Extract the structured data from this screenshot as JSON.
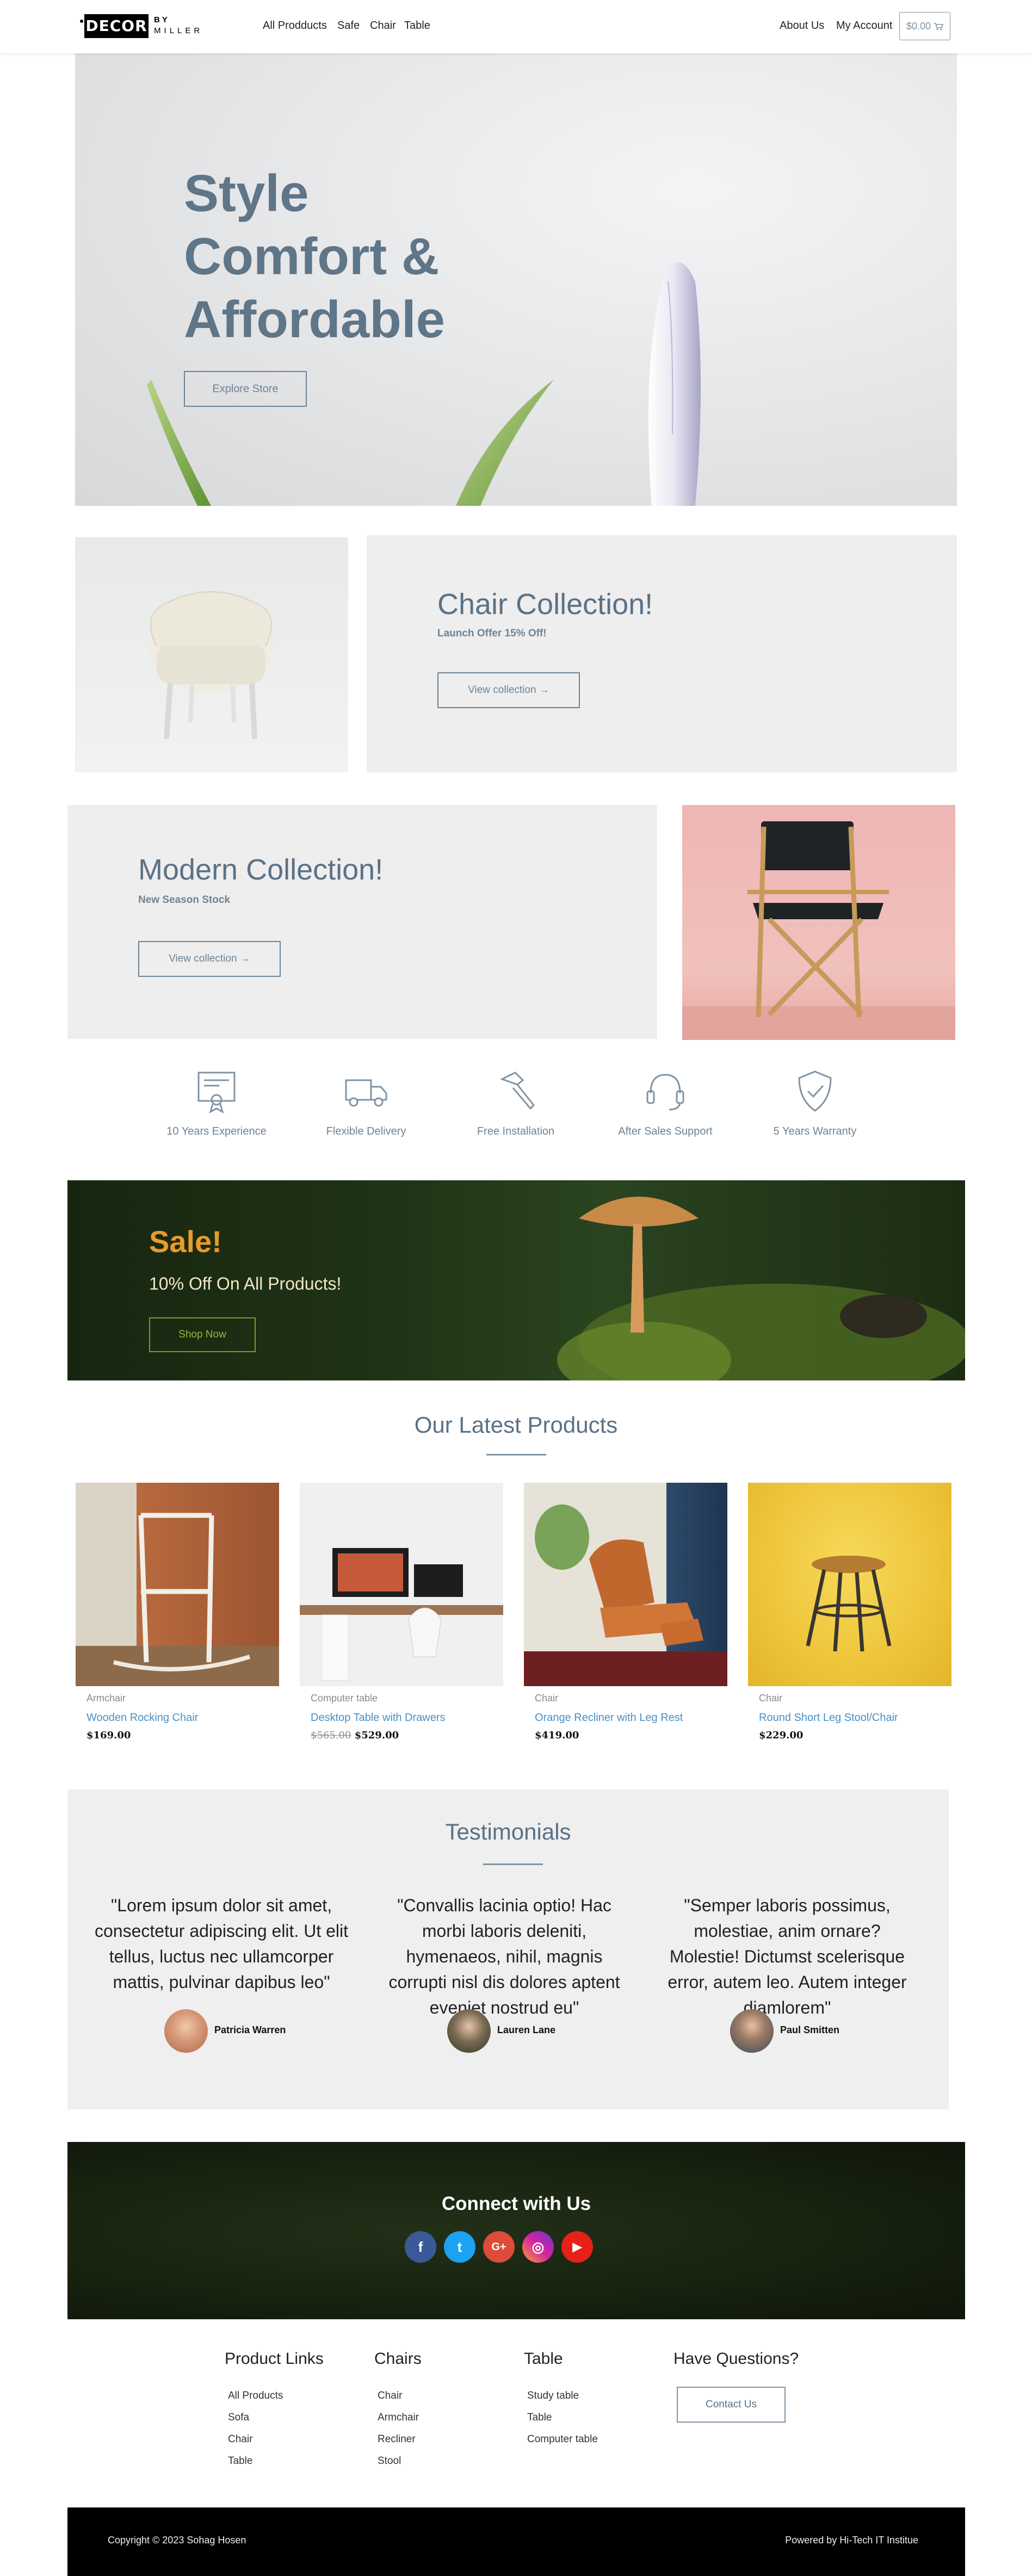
{
  "nav": {
    "logo_main": "DECOR",
    "logo_by": "BY",
    "logo_sub": "MILLER",
    "links": [
      "All Prodducts",
      "Safe",
      "Chair",
      "Table"
    ],
    "right_links": [
      "About Us",
      "My Account"
    ],
    "cart_label": "$0.00",
    "cart_icon": "cart-icon"
  },
  "hero": {
    "title_lines": [
      "Style",
      "Comfort &",
      "Affordable"
    ],
    "button": "Explore Store"
  },
  "chair_collection": {
    "title": "Chair Collection!",
    "subtitle": "Launch Offer 15% Off!",
    "button": "View collection →"
  },
  "modern_collection": {
    "title": "Modern Collection!",
    "subtitle": "New Season Stock",
    "button": "View collection →"
  },
  "features": [
    {
      "label": "10 Years Experience",
      "icon": "certificate-icon"
    },
    {
      "label": "Flexible Delivery",
      "icon": "truck-icon"
    },
    {
      "label": "Free Installation",
      "icon": "hammer-icon"
    },
    {
      "label": "After Sales Support",
      "icon": "headset-icon"
    },
    {
      "label": "5 Years Warranty",
      "icon": "shield-check-icon"
    }
  ],
  "sale": {
    "title": "Sale!",
    "subtitle": "10% Off On All Products!",
    "button": "Shop Now"
  },
  "latest": {
    "title": "Our Latest Products",
    "products": [
      {
        "category": "Armchair",
        "name": "Wooden Rocking Chair",
        "old_price": "",
        "price": "$169.00"
      },
      {
        "category": "Computer table",
        "name": "Desktop Table with Drawers",
        "old_price": "$565.00",
        "price": "$529.00"
      },
      {
        "category": "Chair",
        "name": "Orange Recliner with Leg Rest",
        "old_price": "",
        "price": "$419.00"
      },
      {
        "category": "Chair",
        "name": "Round Short Leg Stool/Chair",
        "old_price": "",
        "price": "$229.00"
      }
    ]
  },
  "testimonials": {
    "title": "Testimonials",
    "items": [
      {
        "quote": "\"Lorem ipsum dolor sit amet, consectetur adipiscing elit. Ut elit tellus, luctus nec ullamcorper mattis, pulvinar dapibus leo\"",
        "name": "Patricia Warren"
      },
      {
        "quote": "\"Convallis lacinia optio! Hac morbi laboris deleniti, hymenaeos, nihil, magnis corrupti nisl dis dolores aptent eveniet nostrud eu\"",
        "name": "Lauren Lane"
      },
      {
        "quote": "\"Semper laboris possimus, molestiae, anim ornare? Molestie! Dictumst scelerisque error, autem leo. Autem integer diamlorem\"",
        "name": "Paul Smitten"
      }
    ]
  },
  "connect": {
    "title": "Connect with Us",
    "socials": [
      {
        "name": "facebook-icon",
        "glyph": "f",
        "color": "#3b5998"
      },
      {
        "name": "twitter-icon",
        "glyph": "t",
        "color": "#1da1f2"
      },
      {
        "name": "google-plus-icon",
        "glyph": "G+",
        "color": "#dd4b39"
      },
      {
        "name": "instagram-icon",
        "glyph": "◎",
        "color": "#c13584"
      },
      {
        "name": "youtube-icon",
        "glyph": "▶",
        "color": "#e62117"
      }
    ]
  },
  "footer": {
    "columns": [
      {
        "heading": "Product Links",
        "links": [
          "All Products",
          "Sofa",
          "Chair",
          "Table"
        ]
      },
      {
        "heading": "Chairs",
        "links": [
          "Chair",
          "Armchair",
          "Recliner",
          "Stool"
        ]
      },
      {
        "heading": "Table",
        "links": [
          "Study table",
          "Table",
          "Computer table"
        ]
      }
    ],
    "question_heading": "Have Questions?",
    "contact_button": "Contact Us",
    "copyright": "Copyright © 2023 Sohag Hosen",
    "powered": "Powered by Hi-Tech IT Institue"
  }
}
